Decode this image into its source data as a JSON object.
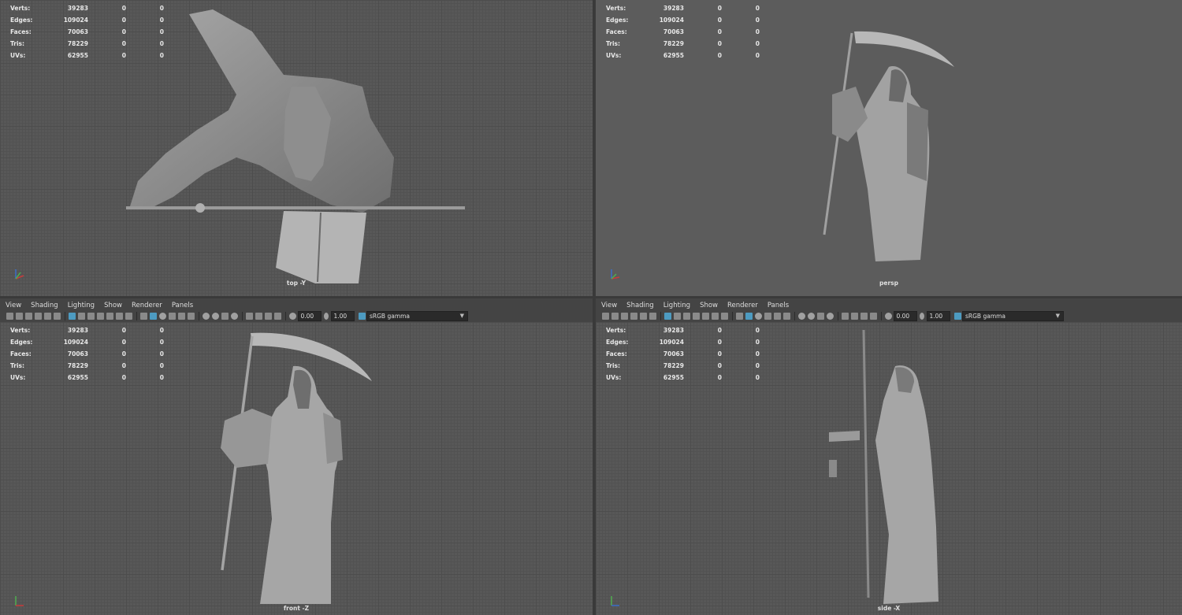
{
  "hud": {
    "rows": [
      {
        "label": "Verts:",
        "v1": "39283",
        "v2": "0",
        "v3": "0"
      },
      {
        "label": "Edges:",
        "v1": "109024",
        "v2": "0",
        "v3": "0"
      },
      {
        "label": "Faces:",
        "v1": "70063",
        "v2": "0",
        "v3": "0"
      },
      {
        "label": "Tris:",
        "v1": "78229",
        "v2": "0",
        "v3": "0"
      },
      {
        "label": "UVs:",
        "v1": "62955",
        "v2": "0",
        "v3": "0"
      }
    ]
  },
  "menu": [
    "View",
    "Shading",
    "Lighting",
    "Show",
    "Renderer",
    "Panels"
  ],
  "toolbar": {
    "exposure": "0.00",
    "gamma": "1.00",
    "colorspace": "sRGB gamma"
  },
  "cameras": {
    "top": "top -Y",
    "persp": "persp",
    "front": "front -Z",
    "side": "side -X"
  },
  "colors": {
    "accent": "#4d9bc1",
    "viewport": "#585858",
    "panel": "#444444"
  },
  "icons": [
    "camera-icon",
    "grid-icon",
    "wireframe-icon",
    "smooth-shade-icon",
    "texture-icon",
    "light-icon",
    "shadow-icon",
    "isolate-icon",
    "xray-icon",
    "resolution-gate-icon"
  ]
}
